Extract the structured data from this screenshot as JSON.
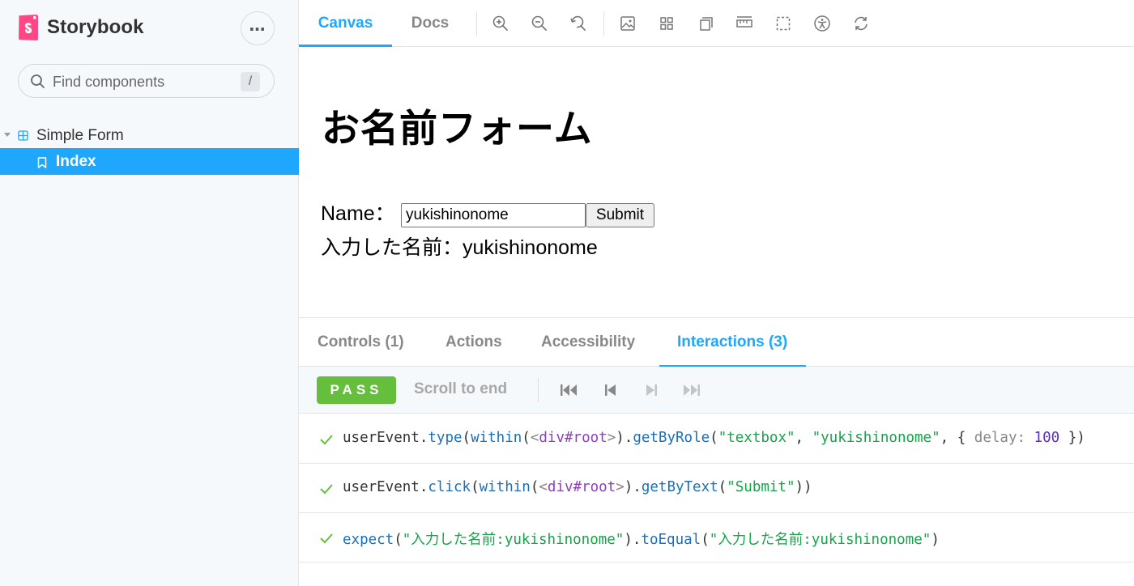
{
  "sidebar": {
    "brand": "Storybook",
    "search": {
      "placeholder": "Find components",
      "shortcut": "/"
    },
    "tree": {
      "group": "Simple Form",
      "item": "Index"
    }
  },
  "toolbar": {
    "tabs": [
      "Canvas",
      "Docs"
    ],
    "active_tab": "Canvas",
    "icons": [
      "zoom-in-icon",
      "zoom-out-icon",
      "zoom-reset-icon",
      "background-icon",
      "grid-icon",
      "viewport-icon",
      "measure-icon",
      "outline-icon",
      "accessibility-icon",
      "remount-icon"
    ]
  },
  "canvas": {
    "title": "お名前フォーム",
    "name_label": "Name：",
    "name_value": "yukishinonome",
    "submit_label": "Submit",
    "result_text": "入力した名前：yukishinonome"
  },
  "panel": {
    "tabs": [
      "Controls (1)",
      "Actions",
      "Accessibility",
      "Interactions (3)"
    ],
    "active_tab": "Interactions (3)",
    "status": "PASS",
    "scroll_to_end": "Scroll to end",
    "steps": [
      {
        "obj": "userEvent",
        "dot1": ".",
        "method": "type",
        "p1": "(",
        "within": "within",
        "p2": "(",
        "lt": "<",
        "el": "div#root",
        "gt": ">",
        "p3": ").",
        "query": "getByRole",
        "p4": "(",
        "arg1": "\"textbox\"",
        "comma1": ", ",
        "arg2": "\"yukishinonome\"",
        "comma2": ", { ",
        "key": "delay:",
        "num": " 100",
        "tail": " })"
      },
      {
        "obj": "userEvent",
        "dot1": ".",
        "method": "click",
        "p1": "(",
        "within": "within",
        "p2": "(",
        "lt": "<",
        "el": "div#root",
        "gt": ">",
        "p3": ").",
        "query": "getByText",
        "p4": "(",
        "arg1": "\"Submit\"",
        "tail": "))"
      },
      {
        "fn": "expect",
        "p1": "(",
        "arg1": "\"入力した名前:yukishinonome\"",
        "p2": ").",
        "method": "toEqual",
        "p3": "(",
        "arg2": "\"入力した名前:yukishinonome\"",
        "tail": ")"
      }
    ]
  },
  "colors": {
    "accent": "#1ea7fd",
    "pass": "#66bf3c",
    "brand": "#ff4785",
    "sidebar_bg": "#f6f9fc"
  }
}
